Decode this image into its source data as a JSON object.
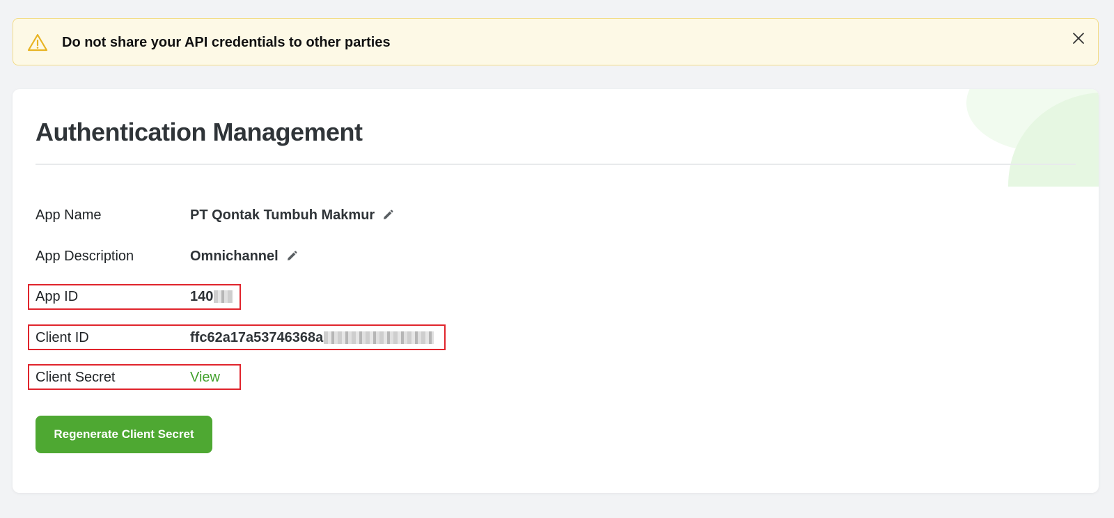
{
  "alert": {
    "message": "Do not share your API credentials to other parties",
    "icon": "warning-icon",
    "close_icon": "close-icon",
    "accent_color": "#e8b423"
  },
  "card": {
    "title": "Authentication Management",
    "fields": [
      {
        "label": "App Name",
        "value": "PT Qontak Tumbuh Makmur",
        "editable": true
      },
      {
        "label": "App Description",
        "value": "Omnichannel",
        "editable": true
      },
      {
        "label": "App ID",
        "value": "140"
      },
      {
        "label": "Client ID",
        "value": "ffc62a17a53746368a"
      },
      {
        "label": "Client Secret",
        "link": "View"
      }
    ],
    "regenerate_button": "Regenerate Client Secret",
    "brand_color": "#4ea832",
    "highlight_color": "#e0242c"
  }
}
